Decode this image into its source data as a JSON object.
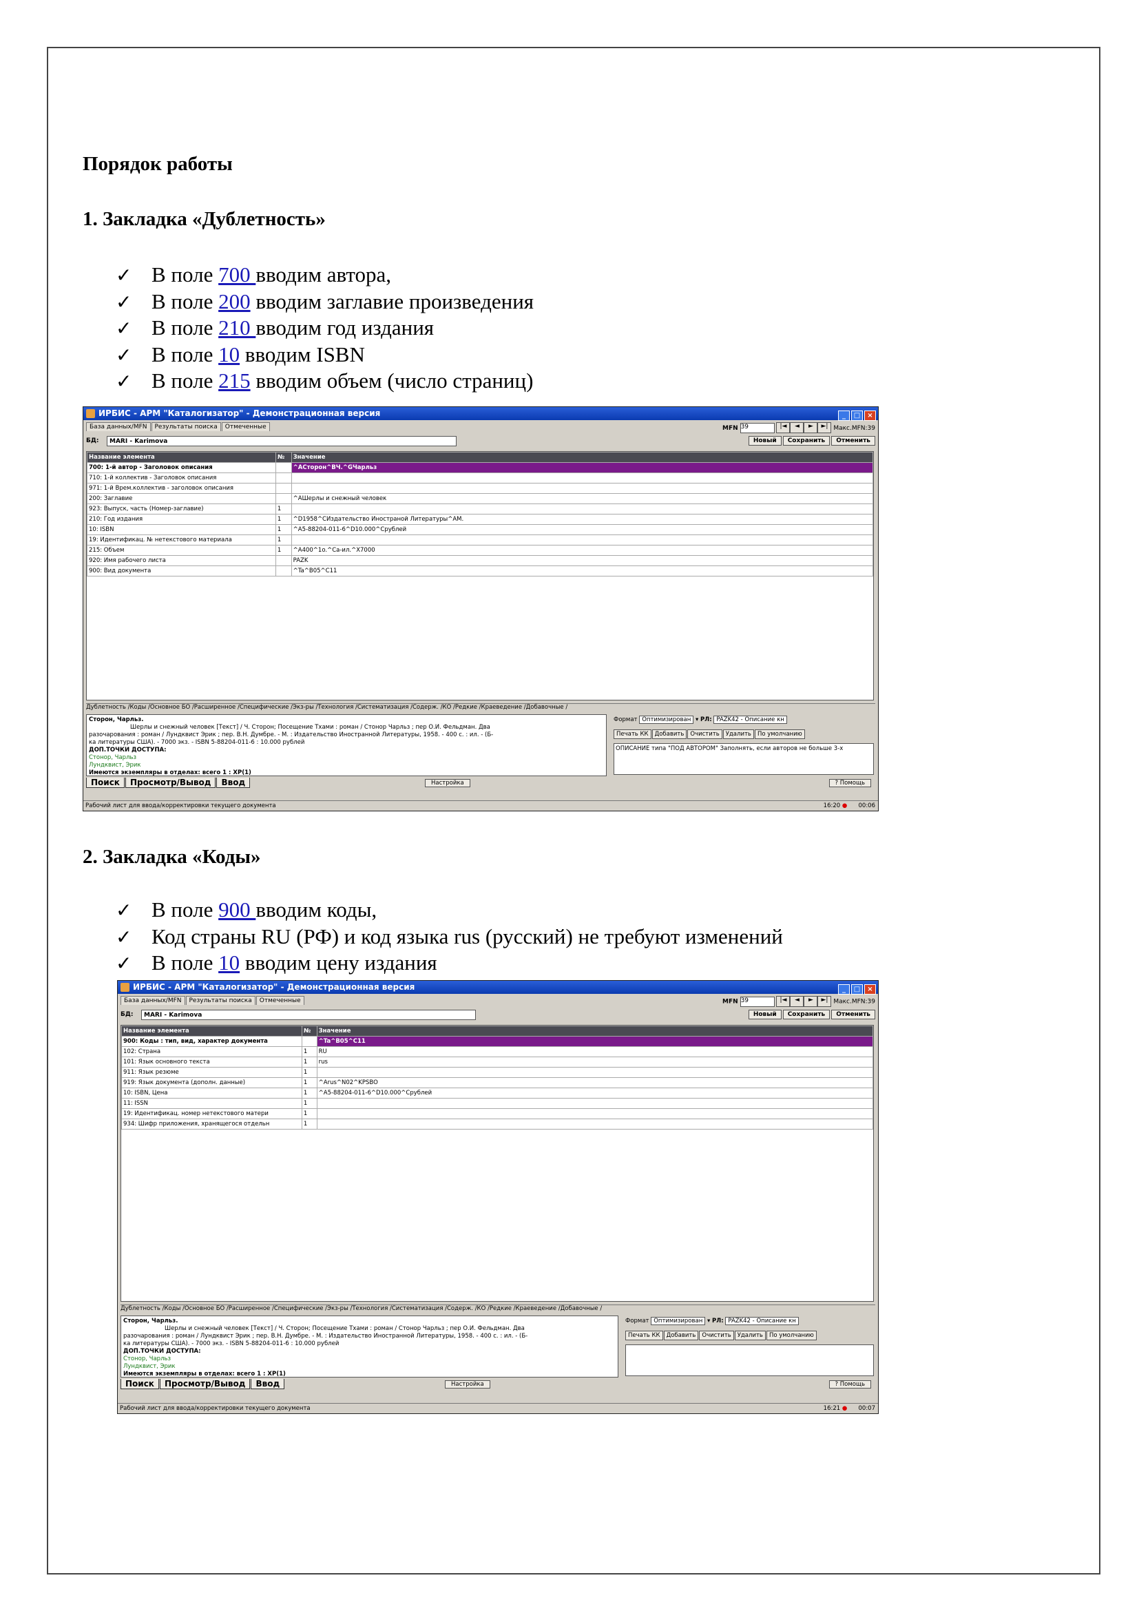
{
  "heading": "Порядок работы",
  "sec1": {
    "title": "1. Закладка «Дублетность»",
    "items": [
      {
        "pre": "В поле ",
        "link": "700 ",
        "post": "вводим автора,"
      },
      {
        "pre": "В поле ",
        "link": "200",
        "post": " вводим заглавие произведения"
      },
      {
        "pre": "В поле ",
        "link": "210 ",
        "post": "вводим год издания"
      },
      {
        "pre": "В поле ",
        "link": "10",
        "post": " вводим ISBN"
      },
      {
        "pre": "В поле ",
        "link": "215",
        "post": " вводим объем (число страниц)"
      }
    ]
  },
  "sec2": {
    "title": "2. Закладка «Коды»",
    "items": [
      {
        "pre": "В поле ",
        "link": "900 ",
        "post": "вводим коды,"
      },
      {
        "pre": "Код страны RU (РФ) и код языка rus (русский) не требуют изменений",
        "link": "",
        "post": ""
      },
      {
        "pre": "В поле ",
        "link": "10",
        "post": " вводим цену издания"
      }
    ]
  },
  "app": {
    "title": "ИРБИС - АРМ \"Каталогизатор\" - Демонстрационная версия",
    "tabs": [
      "База данных/MFN",
      "Результаты поиска",
      "Отмеченные"
    ],
    "mfn_label": "MFN",
    "mfn_value": "39",
    "max_mfn": "Макс.MFN:39",
    "db_label": "БД:",
    "db_value": "MARI - Karimova",
    "btn_new": "Новый",
    "btn_save": "Сохранить",
    "btn_cancel": "Отменить",
    "col_name": "Название элемента",
    "col_no": "№",
    "col_value": "Значение",
    "format_label": "Формат",
    "format_value": "Оптимизирован",
    "rl_label": "РЛ:",
    "rl_value": "PAZK42 - Описание кн",
    "side_buttons": [
      "Печать КК",
      "Добавить",
      "Очистить",
      "Удалить",
      "По умолчанию"
    ],
    "modes": [
      "Поиск",
      "Просмотр/Вывод",
      "Ввод"
    ],
    "settings": "Настройка",
    "help": "Помощь",
    "status": "Рабочий лист для ввода/корректировки текущего документа",
    "bottom_tabs": "Дублетность /Коды /Основное БО /Расширенное /Специфические /Экз-ры /Технология /Систематизация /Содерж. /КО /Редкие /Краеведение /Добавочные /",
    "info": {
      "author": "Сторон, Чарльз.",
      "line1": "Шерлы и снежный человек [Текст] / Ч. Сторон; Посещение Тхами : роман / Стонор Чарльз ; пер О.И. Фельдман. Два",
      "line2": "разочарования : роман / Лундквист Эрик ; пер. В.Н. Думбре. - М. : Издательство Иностранной Литературы, 1958. - 400 с. : ил. - (Б-",
      "line3": "ка литературы США). - 7000 экз. - ISBN 5-88204-011-6 : 10.000 рублей",
      "access": "ДОП.ТОЧКИ ДОСТУПА:",
      "p1": "Стонор, Чарльз",
      "p2": "Лундквист, Эрик",
      "copies": "Имеются экземпляры в отделах:  всего  1 : ХР(1)"
    }
  },
  "win1": {
    "rows": [
      {
        "name": "700: 1-й автор - Заголовок описания",
        "no": "",
        "value": "^AСторон^BЧ.^GЧарльз"
      },
      {
        "name": "710: 1-й коллектив - Заголовок описания",
        "no": "",
        "value": ""
      },
      {
        "name": "971: 1-й Врем.коллектив - заголовок описания",
        "no": "",
        "value": ""
      },
      {
        "name": "200: Заглавие",
        "no": "",
        "value": "^AШерлы и снежный человек"
      },
      {
        "name": "923: Выпуск, часть (Номер-заглавие)",
        "no": "1",
        "value": ""
      },
      {
        "name": "210: Год издания",
        "no": "1",
        "value": "^D1958^CИздательство Иностраной Литературы^AМ."
      },
      {
        "name": "10: ISBN",
        "no": "1",
        "value": "^A5-88204-011-6^D10.000^Cрублей"
      },
      {
        "name": "19: Идентификац. № нетекстового материала",
        "no": "1",
        "value": ""
      },
      {
        "name": "215: Объем",
        "no": "1",
        "value": "^A400^1o.^Cа-ил.^X7000"
      },
      {
        "name": "920: Имя рабочего листа",
        "no": "",
        "value": "PAZK"
      },
      {
        "name": "900: Вид документа",
        "no": "",
        "value": "^Ta^B05^C11"
      }
    ],
    "note": "ОПИСАНИЕ типа \"ПОД АВТОРОМ\"   Заполнять, если авторов не больше 3-х",
    "clock": "16:20",
    "timer": "00:06"
  },
  "win2": {
    "rows": [
      {
        "name": "900: Коды : тип, вид, характер документа",
        "no": "",
        "value": "^Ta^B05^C11"
      },
      {
        "name": "102: Страна",
        "no": "1",
        "value": "RU"
      },
      {
        "name": "101: Язык основного текста",
        "no": "1",
        "value": "rus"
      },
      {
        "name": "911: Язык резюме",
        "no": "1",
        "value": ""
      },
      {
        "name": "919: Язык документа (дополн. данные)",
        "no": "1",
        "value": "^Arus^N02^KPSBO"
      },
      {
        "name": "10: ISBN, Цена",
        "no": "1",
        "value": "^A5-88204-011-6^D10.000^Cрублей"
      },
      {
        "name": "11: ISSN",
        "no": "1",
        "value": ""
      },
      {
        "name": "19: Идентификац. номер нетекстового матери",
        "no": "1",
        "value": ""
      },
      {
        "name": "934: Шифр приложения, хранящегося отдельн",
        "no": "1",
        "value": ""
      }
    ],
    "note": "",
    "clock": "16:21",
    "timer": "00:07"
  }
}
